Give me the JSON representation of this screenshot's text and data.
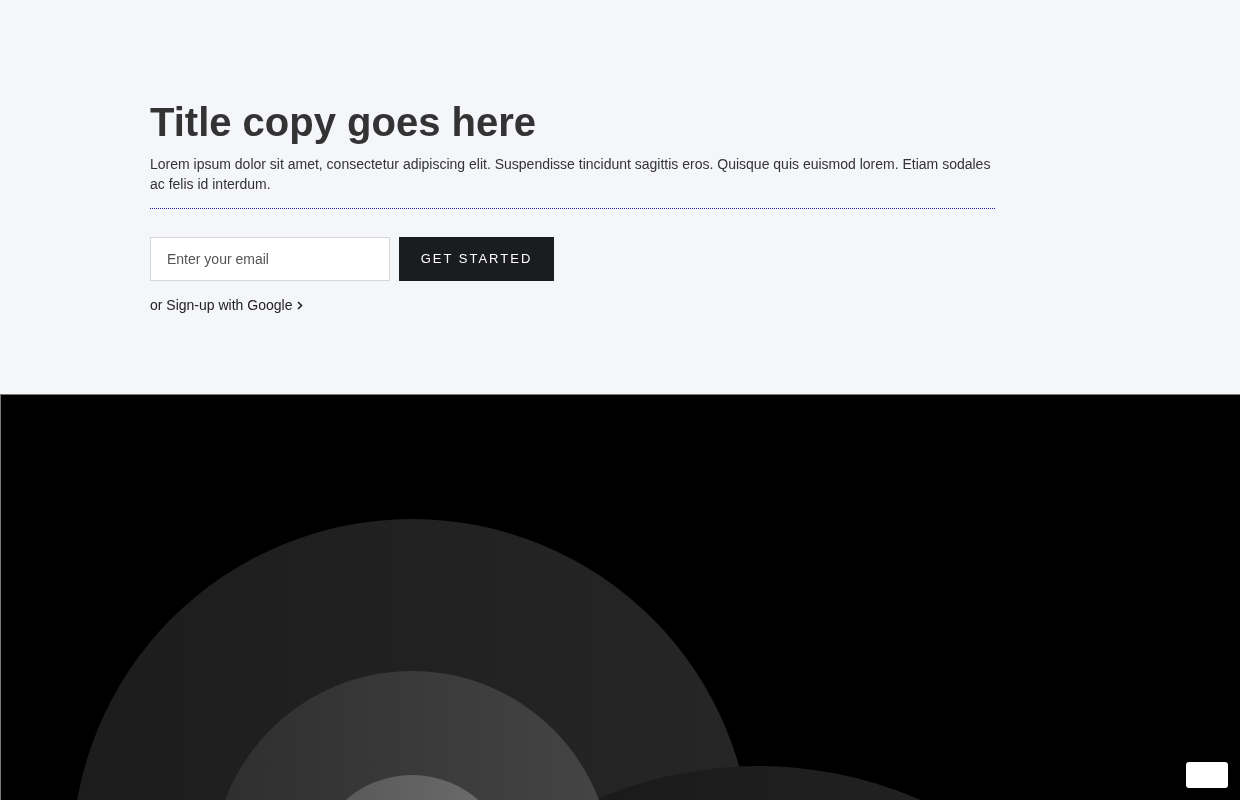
{
  "hero": {
    "title": "Title copy goes here",
    "description": "Lorem ipsum dolor sit amet, consectetur adipiscing elit. Suspendisse tincidunt sagittis eros. Quisque quis euismod lorem. Etiam sodales ac felis id interdum.",
    "email_field": {
      "placeholder": "Enter your email"
    },
    "submit_button": "GET STARTED",
    "google_link": "or Sign-up with Google"
  }
}
